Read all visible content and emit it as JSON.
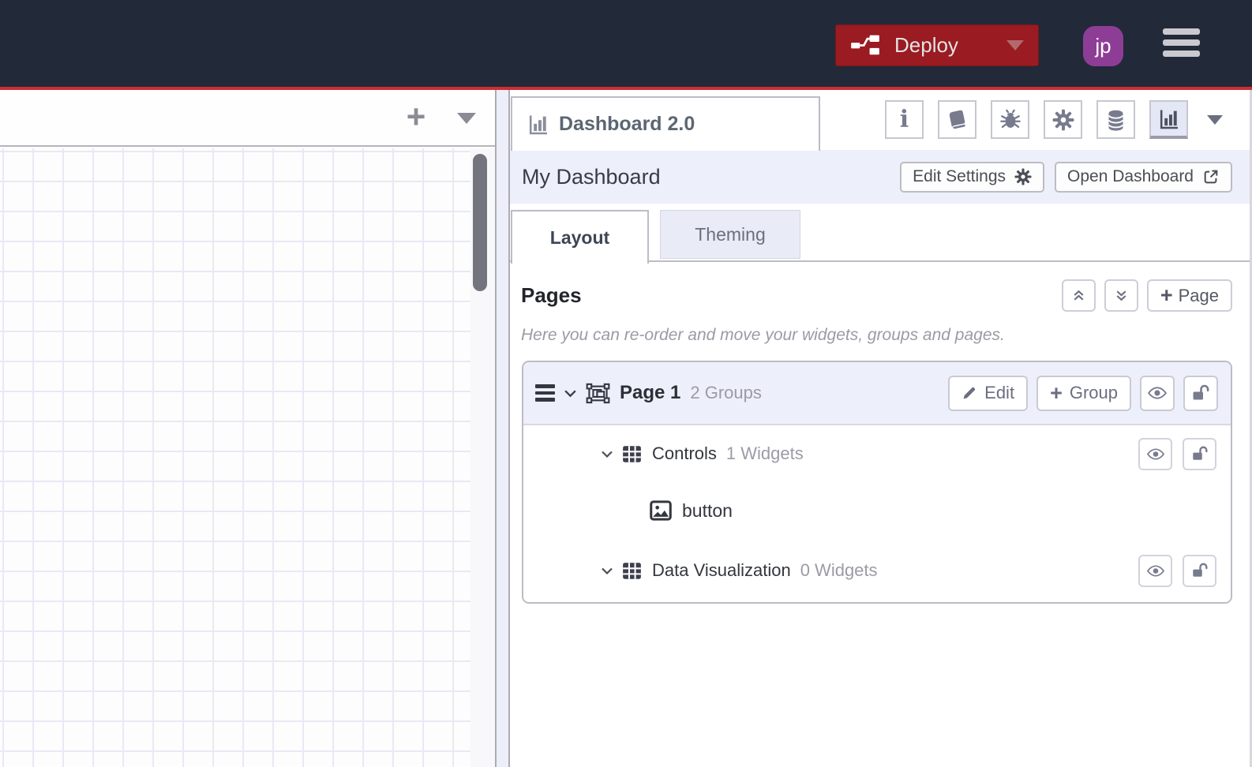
{
  "header": {
    "deploy_label": "Deploy",
    "avatar_initials": "jp",
    "menu_icon": "hamburger-icon"
  },
  "workspace": {
    "add_flow_icon": "plus-icon",
    "flow_list_icon": "chevron-down-icon",
    "add_flow_glyph": "+"
  },
  "sidebar": {
    "panel_tab": {
      "icon": "bar-chart-icon",
      "label": "Dashboard 2.0"
    },
    "toolbar": [
      {
        "name": "info",
        "icon": "info-icon"
      },
      {
        "name": "help",
        "icon": "book-icon"
      },
      {
        "name": "debug",
        "icon": "bug-icon"
      },
      {
        "name": "config-nodes",
        "icon": "gear-icon"
      },
      {
        "name": "context-data",
        "icon": "database-icon"
      },
      {
        "name": "dashboard",
        "icon": "bar-chart-icon",
        "active": true
      }
    ],
    "dashboard_header": {
      "title": "My Dashboard",
      "edit_settings_label": "Edit Settings",
      "open_dashboard_label": "Open Dashboard"
    },
    "tabs": [
      {
        "label": "Layout",
        "active": true
      },
      {
        "label": "Theming",
        "active": false
      }
    ],
    "pages": {
      "title": "Pages",
      "add_page_label": "Page",
      "description": "Here you can re-order and move your widgets, groups and pages.",
      "page": {
        "name": "Page 1",
        "meta": "2 Groups",
        "edit_label": "Edit",
        "add_group_label": "Group",
        "groups": [
          {
            "name": "Controls",
            "meta": "1 Widgets",
            "widgets": [
              {
                "name": "button"
              }
            ]
          },
          {
            "name": "Data Visualization",
            "meta": "0 Widgets",
            "widgets": []
          }
        ]
      }
    }
  },
  "colors": {
    "header_bg": "#222938",
    "accent_red": "#cb2e31",
    "deploy_red": "#9a1b21",
    "avatar_purple": "#8e3d97",
    "lavender": "#edeffa",
    "border_gray": "#bcbcc4",
    "icon_gray": "#787b8e",
    "text_dark": "#33363d",
    "text_gray": "#9b9ba6"
  }
}
